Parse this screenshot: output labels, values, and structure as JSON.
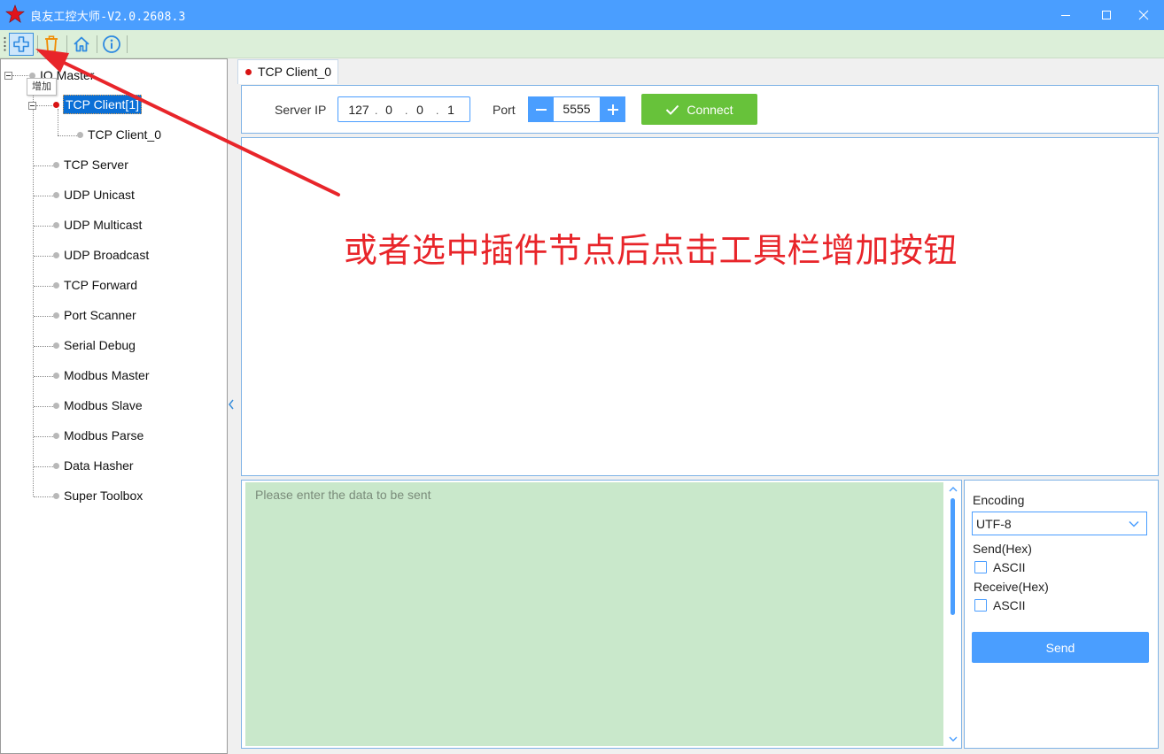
{
  "window": {
    "title": "良友工控大师-V2.0.2608.3",
    "controls": [
      "minimize-icon",
      "maximize-icon",
      "close-icon"
    ]
  },
  "toolbar": {
    "buttons": [
      {
        "name": "add",
        "icon": "plus-icon",
        "tooltip": "增加"
      },
      {
        "name": "delete",
        "icon": "trash-icon"
      },
      {
        "name": "home",
        "icon": "home-icon"
      },
      {
        "name": "about",
        "icon": "info-icon"
      }
    ],
    "tooltip": "增加"
  },
  "tree": {
    "root": "IO Master",
    "items": [
      {
        "label": "TCP Client[1]",
        "selected": true,
        "status": "red",
        "children": [
          {
            "label": "TCP Client_0"
          }
        ]
      },
      {
        "label": "TCP Server"
      },
      {
        "label": "UDP Unicast"
      },
      {
        "label": "UDP Multicast"
      },
      {
        "label": "UDP Broadcast"
      },
      {
        "label": "TCP Forward"
      },
      {
        "label": "Port Scanner"
      },
      {
        "label": "Serial Debug"
      },
      {
        "label": "Modbus Master"
      },
      {
        "label": "Modbus Slave"
      },
      {
        "label": "Modbus Parse"
      },
      {
        "label": "Data Hasher"
      },
      {
        "label": "Super Toolbox"
      }
    ]
  },
  "tab": {
    "label": "TCP Client_0"
  },
  "connection": {
    "server_ip_label": "Server IP",
    "ip": [
      "127",
      "0",
      "0",
      "1"
    ],
    "port_label": "Port",
    "port": "5555",
    "connect_label": "Connect"
  },
  "send": {
    "placeholder": "Please enter the data to be sent",
    "encoding_label": "Encoding",
    "encoding": "UTF-8",
    "send_hex_label": "Send(Hex)",
    "send_ascii_label": "ASCII",
    "receive_hex_label": "Receive(Hex)",
    "receive_ascii_label": "ASCII",
    "send_button": "Send"
  },
  "annotation": {
    "text": "或者选中插件节点后点击工具栏增加按钮"
  },
  "colors": {
    "titlebar": "#4a9eff",
    "toolbar": "#dcefd9",
    "accent": "#4a9eff",
    "connect": "#67c23a",
    "send_input_bg": "#c9e8cb",
    "annotation": "#e8252a"
  }
}
